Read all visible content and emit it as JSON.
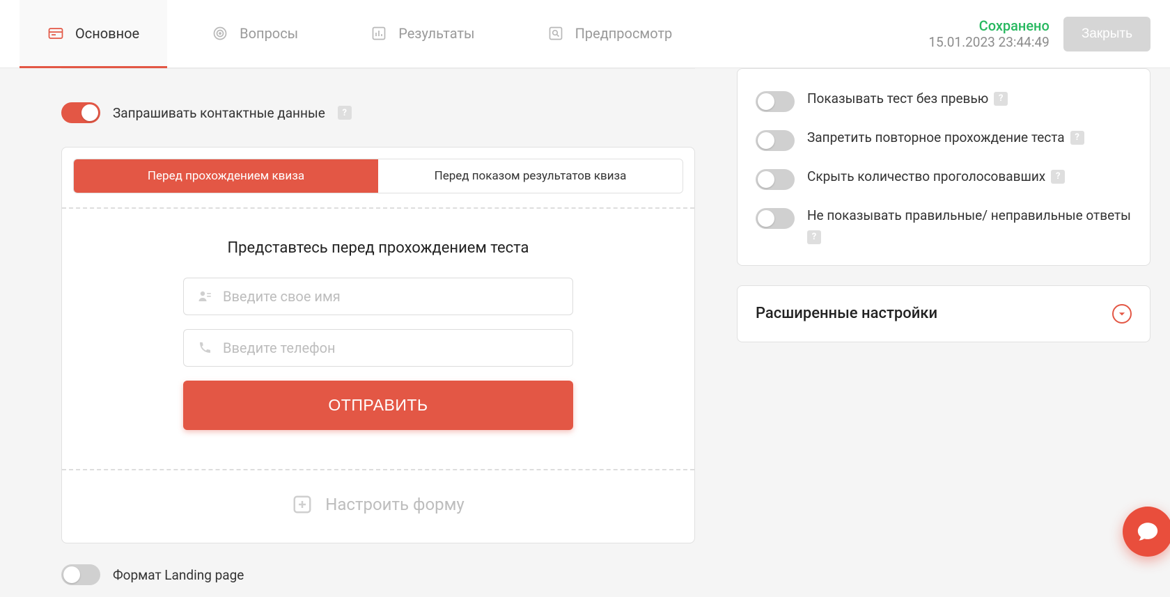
{
  "tabs": {
    "main": {
      "label": "Основное"
    },
    "questions": {
      "label": "Вопросы"
    },
    "results": {
      "label": "Результаты"
    },
    "preview": {
      "label": "Предпросмотр"
    }
  },
  "status": {
    "saved": "Сохранено",
    "time": "15.01.2023 23:44:49",
    "close": "Закрыть"
  },
  "left": {
    "request_contact_label": "Запрашивать контактные данные",
    "segments": {
      "before_quiz": "Перед прохождением квиза",
      "before_results": "Перед показом результатов квиза"
    },
    "form": {
      "title": "Представтесь перед прохождением теста",
      "name_placeholder": "Введите свое имя",
      "phone_placeholder": "Введите телефон",
      "submit": "ОТПРАВИТЬ"
    },
    "configure_label": "Настроить форму",
    "landing_label": "Формат Landing page"
  },
  "right": {
    "options": {
      "no_preview": "Показывать тест без превью",
      "disallow_retake": "Запретить повторное прохождение теста",
      "hide_vote_count": "Скрыть количество проголосовавших",
      "hide_correctness": "Не показывать правильные/ неправильные ответы"
    },
    "advanced_title": "Расширенные настройки"
  },
  "help_glyph": "?"
}
